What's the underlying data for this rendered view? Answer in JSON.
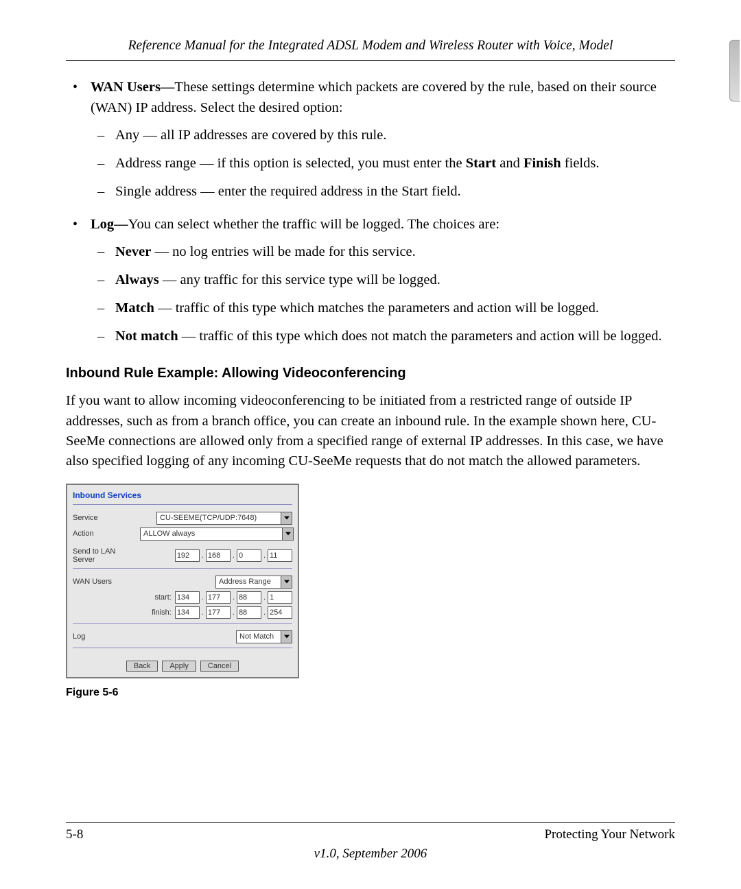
{
  "header": {
    "running": "Reference Manual for the Integrated ADSL Modem and Wireless Router with Voice, Model"
  },
  "wan_users": {
    "lead_bold": "WAN Users—",
    "lead_rest": "These settings determine which packets are covered by the rule, based on their source (WAN) IP address. Select the desired option:",
    "items": {
      "any": "Any — all IP addresses are covered by this rule.",
      "range_pre": "Address range — if this option is selected, you must enter the ",
      "range_start": "Start",
      "range_mid": " and ",
      "range_finish": "Finish",
      "range_post": " fields.",
      "single": "Single address — enter the required address in the Start field."
    }
  },
  "log": {
    "lead_bold": "Log—",
    "lead_rest": "You can select whether the traffic will be logged. The choices are:",
    "never_b": "Never",
    "never_rest": " — no log entries will be made for this service.",
    "always_b": "Always",
    "always_rest": " — any traffic for this service type will be logged.",
    "match_b": "Match",
    "match_rest": " — traffic of this type which matches the parameters and action will be logged.",
    "notmatch_b": "Not match",
    "notmatch_rest": " — traffic of this type which does not match the parameters and action will be logged."
  },
  "section_heading": "Inbound Rule Example: Allowing Videoconferencing",
  "body_para": "If you want to allow incoming videoconferencing to be initiated from a restricted range of outside IP addresses, such as from a branch office, you can create an inbound rule. In the example shown here, CU-SeeMe connections are allowed only from a specified range of external IP addresses. In this case, we have also specified logging of any incoming CU-SeeMe requests that do not match the allowed parameters.",
  "panel": {
    "title": "Inbound Services",
    "labels": {
      "service": "Service",
      "action": "Action",
      "send_to": "Send to LAN Server",
      "wan_users": "WAN Users",
      "log": "Log",
      "start_prefix": "start:",
      "finish_prefix": "finish:"
    },
    "values": {
      "service": "CU-SEEME(TCP/UDP:7648)",
      "action": "ALLOW always",
      "lan_ip": [
        "192",
        "168",
        "0",
        "11"
      ],
      "wan_mode": "Address Range",
      "start_ip": [
        "134",
        "177",
        "88",
        "1"
      ],
      "finish_ip": [
        "134",
        "177",
        "88",
        "254"
      ],
      "log": "Not Match"
    },
    "buttons": {
      "back": "Back",
      "apply": "Apply",
      "cancel": "Cancel"
    }
  },
  "figure_caption": "Figure 5-6",
  "footer": {
    "page": "5-8",
    "chapter": "Protecting Your Network",
    "version": "v1.0, September 2006"
  }
}
